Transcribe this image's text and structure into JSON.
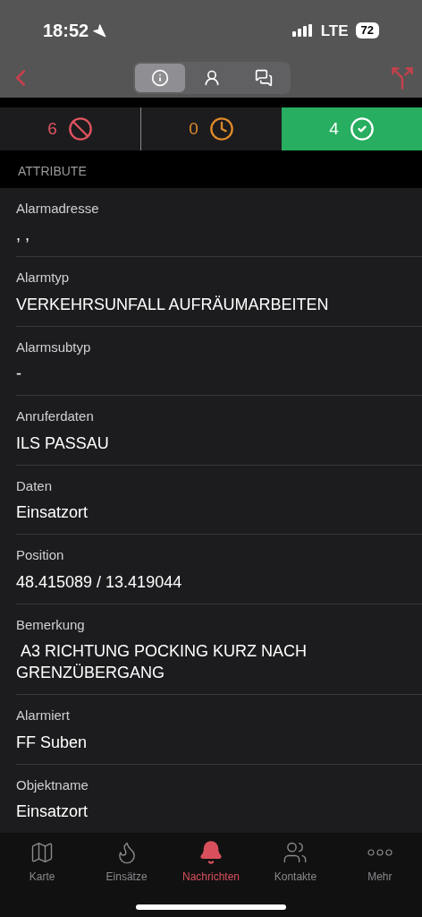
{
  "status_bar": {
    "time": "18:52",
    "network": "LTE",
    "battery": "72"
  },
  "segments": [
    {
      "kind": "info",
      "selected": true
    },
    {
      "kind": "person",
      "selected": false
    },
    {
      "kind": "chat",
      "selected": false
    }
  ],
  "counters": [
    {
      "kind": "declined",
      "count": "6",
      "selected": false
    },
    {
      "kind": "pending",
      "count": "0",
      "selected": false
    },
    {
      "kind": "accepted",
      "count": "4",
      "selected": true
    }
  ],
  "section_title": "ATTRIBUTE",
  "attributes": [
    {
      "label": "Alarmadresse",
      "value": ", ,"
    },
    {
      "label": "Alarmtyp",
      "value": "VERKEHRSUNFALL AUFRÄUMARBEITEN"
    },
    {
      "label": "Alarmsubtyp",
      "value": "-"
    },
    {
      "label": "Anruferdaten",
      "value": "ILS PASSAU"
    },
    {
      "label": "Daten",
      "value": "Einsatzort"
    },
    {
      "label": "Position",
      "value": "48.415089 / 13.419044"
    },
    {
      "label": "Bemerkung",
      "value": " A3 RICHTUNG POCKING KURZ NACH GRENZÜBERGANG"
    },
    {
      "label": "Alarmiert",
      "value": "FF Suben"
    },
    {
      "label": "Objektname",
      "value": "Einsatzort"
    }
  ],
  "tab_bar": [
    {
      "kind": "map",
      "label": "Karte",
      "selected": false
    },
    {
      "kind": "flame",
      "label": "Einsätze",
      "selected": false
    },
    {
      "kind": "bell",
      "label": "Nachrichten",
      "selected": true
    },
    {
      "kind": "people",
      "label": "Kontakte",
      "selected": false
    },
    {
      "kind": "more",
      "label": "Mehr",
      "selected": false
    }
  ]
}
